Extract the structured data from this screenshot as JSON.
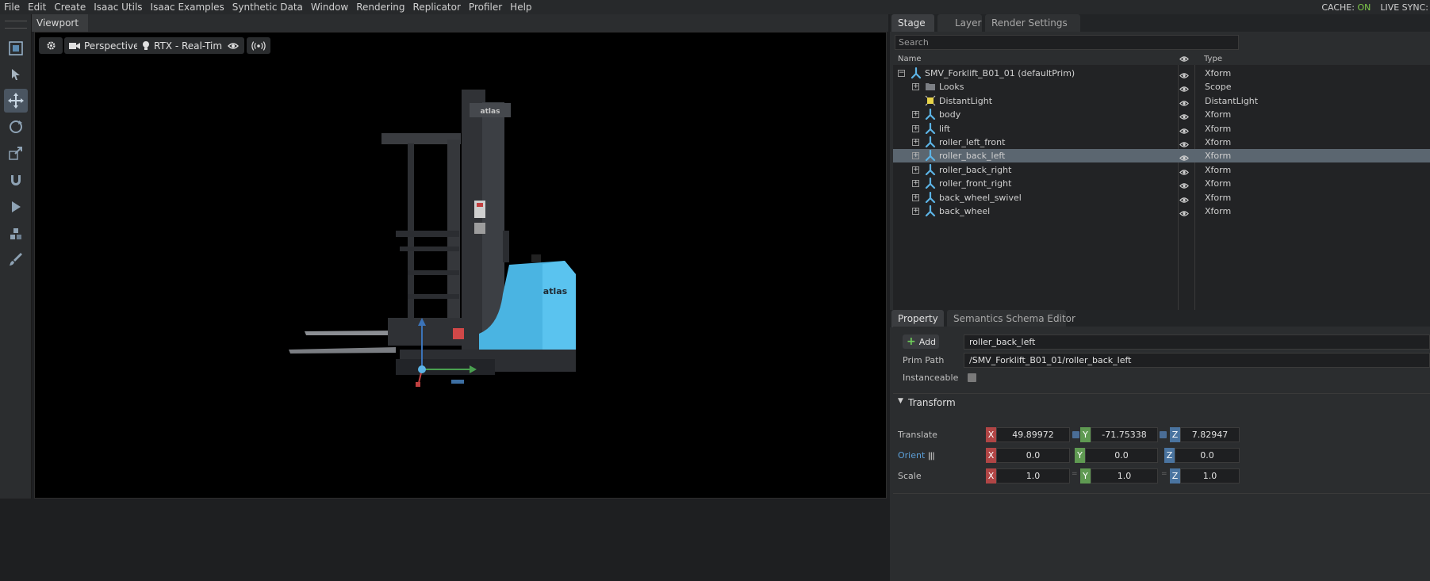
{
  "menu": {
    "items": [
      "File",
      "Edit",
      "Create",
      "Isaac Utils",
      "Isaac Examples",
      "Synthetic Data",
      "Window",
      "Rendering",
      "Replicator",
      "Profiler",
      "Help"
    ],
    "cache_label": "CACHE:",
    "cache_value": "ON",
    "live_sync_label": "LIVE SYNC:"
  },
  "viewport": {
    "tab_label": "Viewport",
    "camera_label": "Perspective",
    "render_mode_label": "RTX - Real-Time",
    "model_brand_text": "atlas"
  },
  "stage": {
    "tabs": [
      "Stage",
      "Layer",
      "Render Settings"
    ],
    "active_tab": "Stage",
    "search_placeholder": "Search",
    "header_name": "Name",
    "header_type": "Type",
    "rows": [
      {
        "name": "SMV_Forklift_B01_01 (defaultPrim)",
        "type": "Xform",
        "icon": "xform-icon",
        "expander": "−",
        "depth": 0,
        "selected": false
      },
      {
        "name": "Looks",
        "type": "Scope",
        "icon": "folder-icon",
        "expander": "+",
        "depth": 1,
        "selected": false
      },
      {
        "name": "DistantLight",
        "type": "DistantLight",
        "icon": "light-icon",
        "expander": "",
        "depth": 1,
        "selected": false
      },
      {
        "name": "body",
        "type": "Xform",
        "icon": "xform-icon",
        "expander": "+",
        "depth": 1,
        "selected": false
      },
      {
        "name": "lift",
        "type": "Xform",
        "icon": "xform-icon",
        "expander": "+",
        "depth": 1,
        "selected": false
      },
      {
        "name": "roller_left_front",
        "type": "Xform",
        "icon": "xform-icon",
        "expander": "+",
        "depth": 1,
        "selected": false
      },
      {
        "name": "roller_back_left",
        "type": "Xform",
        "icon": "xform-icon",
        "expander": "+",
        "depth": 1,
        "selected": true
      },
      {
        "name": "roller_back_right",
        "type": "Xform",
        "icon": "xform-icon",
        "expander": "+",
        "depth": 1,
        "selected": false
      },
      {
        "name": "roller_front_right",
        "type": "Xform",
        "icon": "xform-icon",
        "expander": "+",
        "depth": 1,
        "selected": false
      },
      {
        "name": "back_wheel_swivel",
        "type": "Xform",
        "icon": "xform-icon",
        "expander": "+",
        "depth": 1,
        "selected": false
      },
      {
        "name": "back_wheel",
        "type": "Xform",
        "icon": "xform-icon",
        "expander": "+",
        "depth": 1,
        "selected": false
      }
    ]
  },
  "property": {
    "tabs": [
      "Property",
      "Semantics Schema Editor"
    ],
    "active_tab": "Property",
    "add_label": "Add",
    "prim_name": "roller_back_left",
    "prim_path_label": "Prim Path",
    "prim_path": "/SMV_Forklift_B01_01/roller_back_left",
    "instanceable_label": "Instanceable",
    "transform_section": "Transform",
    "translate_label": "Translate",
    "orient_label": "Orient",
    "scale_label": "Scale",
    "translate": {
      "x": "49.89972",
      "y": "-71.75338",
      "z": "7.82947"
    },
    "orient": {
      "x": "0.0",
      "y": "0.0",
      "z": "0.0"
    },
    "scale": {
      "x": "1.0",
      "y": "1.0",
      "z": "1.0"
    },
    "axis_x": "X",
    "axis_y": "Y",
    "axis_z": "Z"
  },
  "colors": {
    "accent_blue": "#5cb4e6",
    "selected_row": "#5b6670",
    "axis_x": "#b04545",
    "axis_y": "#5f9a52",
    "axis_z": "#4a74a0",
    "cache_on": "#7fc94a"
  }
}
